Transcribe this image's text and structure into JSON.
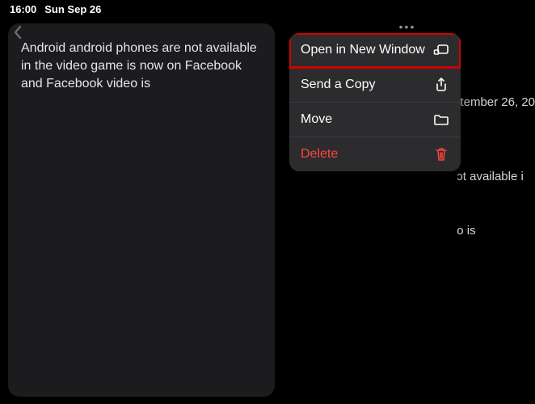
{
  "statusbar": {
    "time": "16:00",
    "date": "Sun Sep 26"
  },
  "note": {
    "preview_text": "Android android phones are not available in the video game is now on Facebook and Facebook video is"
  },
  "behind": {
    "line1": "ıtember 26, 20",
    "line2": "ɔt available i",
    "line3": "o is"
  },
  "menu": {
    "open_new_window": "Open in New Window",
    "send_copy": "Send a Copy",
    "move": "Move",
    "delete": "Delete"
  }
}
